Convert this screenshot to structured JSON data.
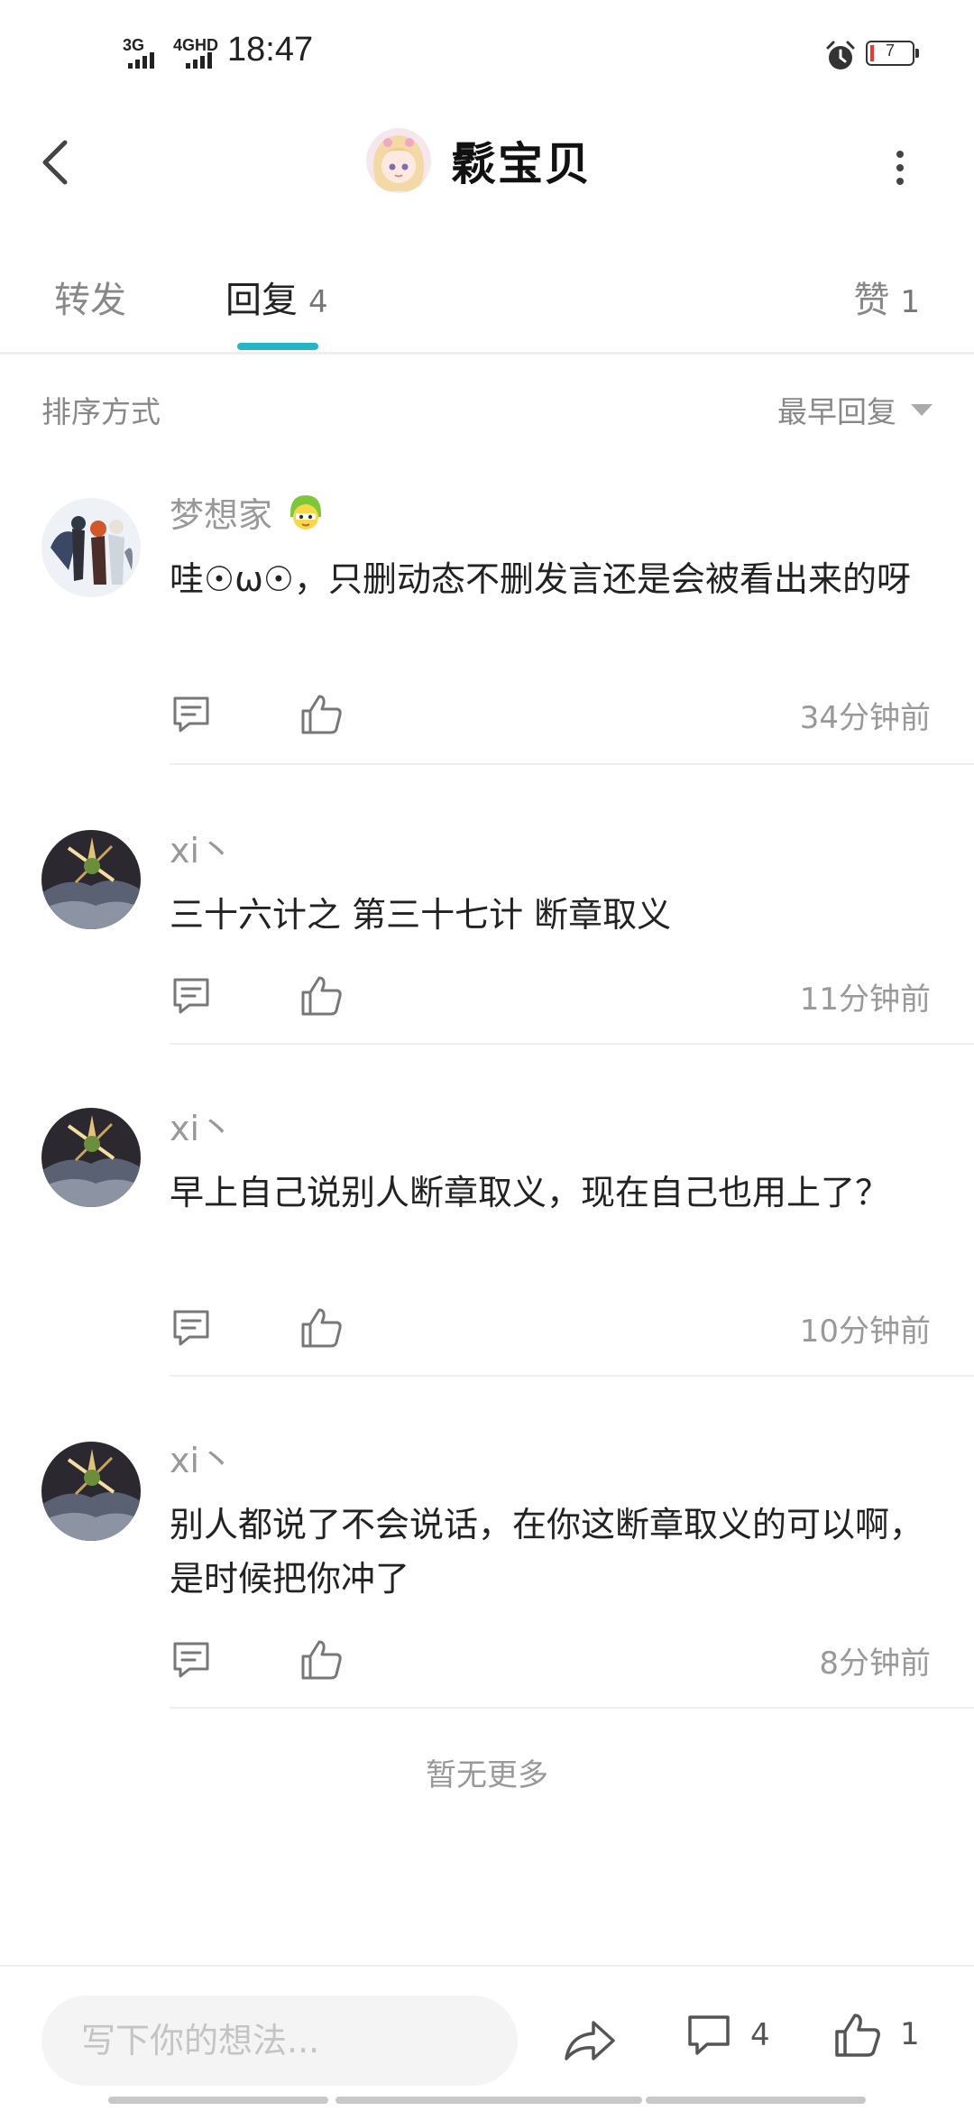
{
  "status_bar": {
    "network_1": "3G",
    "network_2": "4GHD",
    "time": "18:47",
    "battery": "7"
  },
  "header": {
    "title": "鬏宝贝",
    "back_icon": "chevron-left-icon",
    "more_icon": "more-vertical-icon"
  },
  "tabs": [
    {
      "label": "转发",
      "count": ""
    },
    {
      "label": "回复",
      "count": "4"
    },
    {
      "label": "赞",
      "count": "1"
    }
  ],
  "active_tab_color": "#26b5c8",
  "sort": {
    "label": "排序方式",
    "value": "最早回复"
  },
  "comments": [
    {
      "name": "梦想家",
      "text": "哇☉ω☉，只删动态不删发言还是会被看出来的呀",
      "time": "34分钟前"
    },
    {
      "name": "xi丶",
      "text": "三十六计之 第三十七计 断章取义",
      "time": "11分钟前"
    },
    {
      "name": "xi丶",
      "text": "早上自己说别人断章取义，现在自己也用上了？",
      "time": "10分钟前"
    },
    {
      "name": "xi丶",
      "text": "别人都说了不会说话，在你这断章取义的可以啊，是时候把你冲了",
      "time": "8分钟前"
    }
  ],
  "no_more": "暂无更多",
  "bottom_bar": {
    "input_placeholder": "写下你的想法...",
    "comment_count": "4",
    "like_count": "1"
  }
}
